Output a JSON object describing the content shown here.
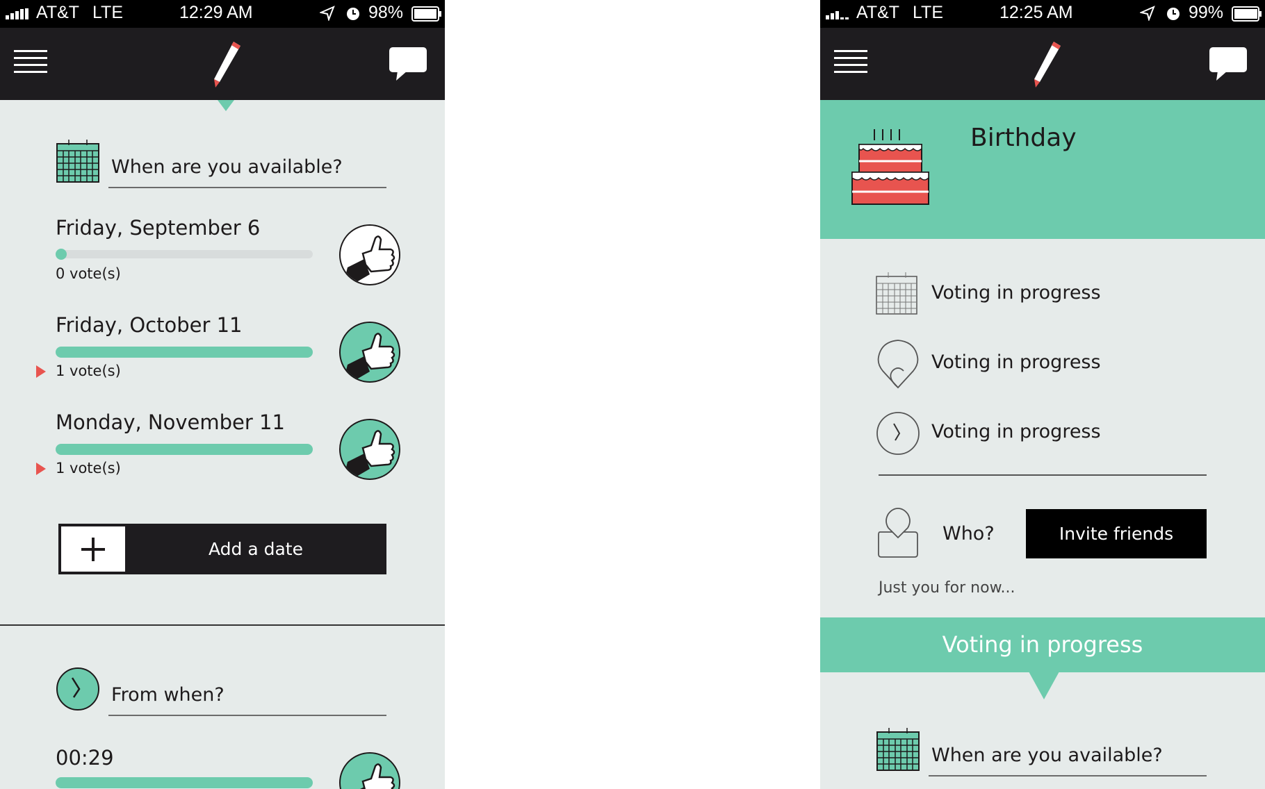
{
  "colors": {
    "accent": "#6dcbad",
    "dark": "#1e1c1f",
    "panel_bg": "#e6ebea",
    "alert": "#e8544f"
  },
  "left_screen": {
    "status": {
      "carrier": "AT&T",
      "network": "LTE",
      "time": "12:29 AM",
      "battery": "98%"
    },
    "date_section": {
      "question": "When are you available?",
      "options": [
        {
          "label": "Friday, September 6",
          "votes": "0 vote(s)",
          "vote_fraction": 0.0,
          "voted": false
        },
        {
          "label": "Friday, October 11",
          "votes": "1 vote(s)",
          "vote_fraction": 1.0,
          "voted": true
        },
        {
          "label": "Monday, November 11",
          "votes": "1 vote(s)",
          "vote_fraction": 1.0,
          "voted": true
        }
      ],
      "add_button_label": "Add a date"
    },
    "time_section": {
      "question": "From when?",
      "options": [
        {
          "label": "00:29",
          "vote_fraction": 1.0,
          "voted": true
        }
      ]
    }
  },
  "right_screen": {
    "status": {
      "carrier": "AT&T",
      "network": "LTE",
      "time": "12:25 AM",
      "battery": "99%"
    },
    "event_title": "Birthday",
    "status_items": [
      {
        "icon": "calendar-icon",
        "text": "Voting in progress"
      },
      {
        "icon": "map-pin-icon",
        "text": "Voting in progress"
      },
      {
        "icon": "clock-icon",
        "text": "Voting in progress"
      }
    ],
    "who_label": "Who?",
    "invite_button_label": "Invite friends",
    "attendees_note": "Just you for now...",
    "voting_banner": "Voting in progress",
    "date_question": "When are you available?"
  }
}
